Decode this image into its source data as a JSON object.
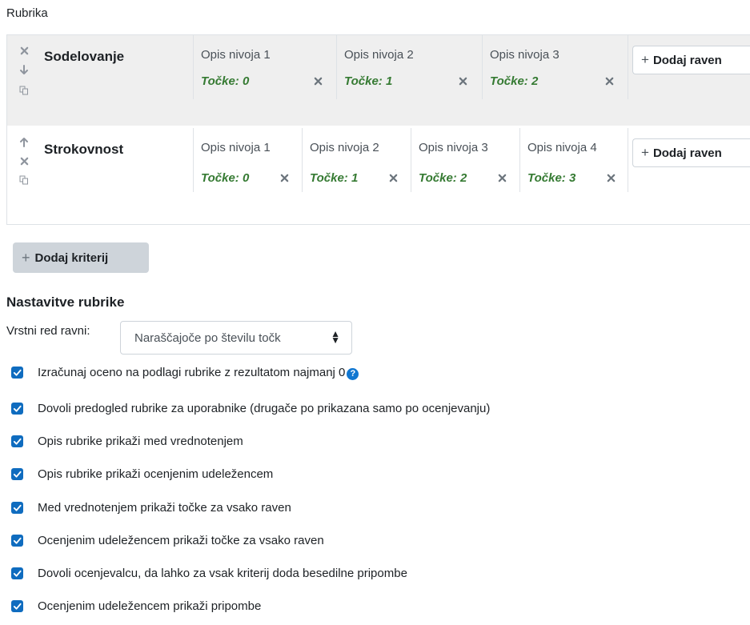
{
  "section_label": "Rubrika",
  "criteria": [
    {
      "name": "Sodelovanje",
      "levels": [
        {
          "description": "Opis nivoja 1",
          "points": "Točke: 0"
        },
        {
          "description": "Opis nivoja 2",
          "points": "Točke: 1"
        },
        {
          "description": "Opis nivoja 3",
          "points": "Točke: 2"
        }
      ],
      "add_level_label": "Dodaj raven"
    },
    {
      "name": "Strokovnost",
      "levels": [
        {
          "description": "Opis nivoja 1",
          "points": "Točke: 0"
        },
        {
          "description": "Opis nivoja 2",
          "points": "Točke: 1"
        },
        {
          "description": "Opis nivoja 3",
          "points": "Točke: 2"
        },
        {
          "description": "Opis nivoja 4",
          "points": "Točke: 3"
        }
      ],
      "add_level_label": "Dodaj raven"
    }
  ],
  "add_criterion_label": "Dodaj kriterij",
  "settings": {
    "title": "Nastavitve rubrike",
    "order_label": "Vrstni red ravni:",
    "order_value": "Naraščajoče po številu točk",
    "options": [
      {
        "label": "Izračunaj oceno na podlagi rubrike z rezultatom najmanj 0",
        "checked": true,
        "help": true
      },
      {
        "label": "Dovoli predogled rubrike za uporabnike (drugače po prikazana samo po ocenjevanju)",
        "checked": true
      },
      {
        "label": "Opis rubrike prikaži med vrednotenjem",
        "checked": true
      },
      {
        "label": "Opis rubrike prikaži ocenjenim udeležencem",
        "checked": true
      },
      {
        "label": "Med vrednotenjem prikaži točke za vsako raven",
        "checked": true
      },
      {
        "label": "Ocenjenim udeležencem prikaži točke za vsako raven",
        "checked": true
      },
      {
        "label": "Dovoli ocenjevalcu, da lahko za vsak kriterij doda besedilne pripombe",
        "checked": true
      },
      {
        "label": "Ocenjenim udeležencem prikaži pripombe",
        "checked": true
      }
    ]
  },
  "colors": {
    "accent": "#0f6cbf",
    "points_text": "#357a32",
    "row_shade": "#efefef"
  }
}
